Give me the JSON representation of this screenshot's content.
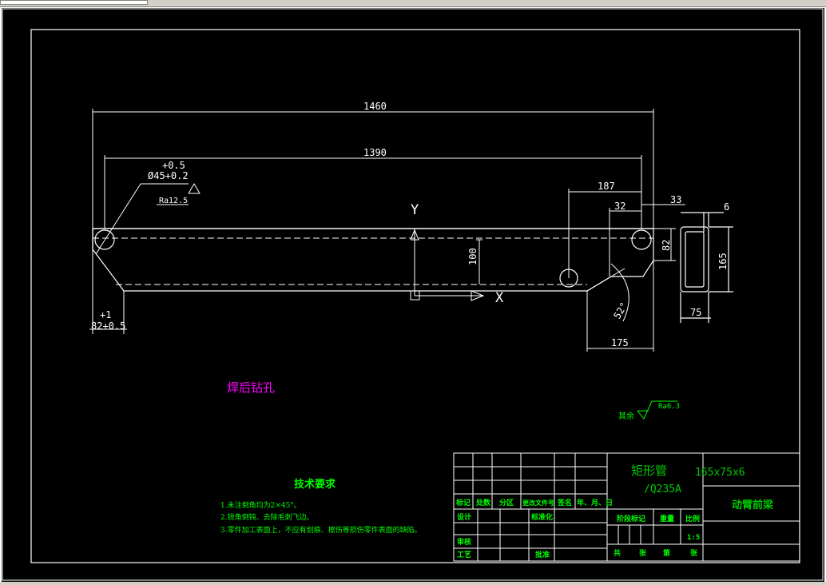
{
  "colors": {
    "background": "#000000",
    "line": "#ffffff",
    "text_green": "#00ff00",
    "text_magenta": "#ff00ff",
    "title_text": "#00cc00",
    "border": "#ffffff"
  },
  "dimensions": {
    "overall_length": "1460",
    "hole_spacing": "1390",
    "tol_upper": "+0.5",
    "hole_dia": "Ø45+0.2",
    "roughness_hole": "Ra12.5",
    "left_tol_top": "+1",
    "left_tol_bottom": "82+0.5",
    "axis_y": "Y",
    "axis_x": "X",
    "offset_100": "100",
    "dim_187": "187",
    "dim_32": "32",
    "dim_33": "33",
    "dim_82": "82",
    "angle": "52°",
    "dim_175": "175",
    "section_6": "6",
    "section_165": "165",
    "section_75": "75"
  },
  "notes": {
    "weld_note": "焊后钻孔",
    "surface_other": "其余",
    "surface_ra": "Ra6.3",
    "tech_title": "技术要求",
    "tech_items": [
      "1.未注倒角均为2×45°。",
      "2.锐角倒钝、去除毛刺飞边。",
      "3.零件加工表面上，不应有划痕、擦伤等损伤零件表面的缺陷。"
    ]
  },
  "title_block": {
    "material_line1": "矩形管",
    "material_spec": "165x75x6",
    "material_line2": "/Q235A",
    "part_name": "动臂前梁",
    "row_labels": [
      "标记",
      "处数",
      "分区",
      "更改文件号",
      "签名",
      "年、月、日"
    ],
    "design": "设计",
    "standardize": "标准化",
    "stage_mark": "阶段标记",
    "weight": "重量",
    "ratio": "比例",
    "scale": "1:5",
    "review": "审核",
    "process": "工艺",
    "approve": "批准",
    "total": "共",
    "sheets": "张",
    "page": "第",
    "sheet_word": "张"
  }
}
